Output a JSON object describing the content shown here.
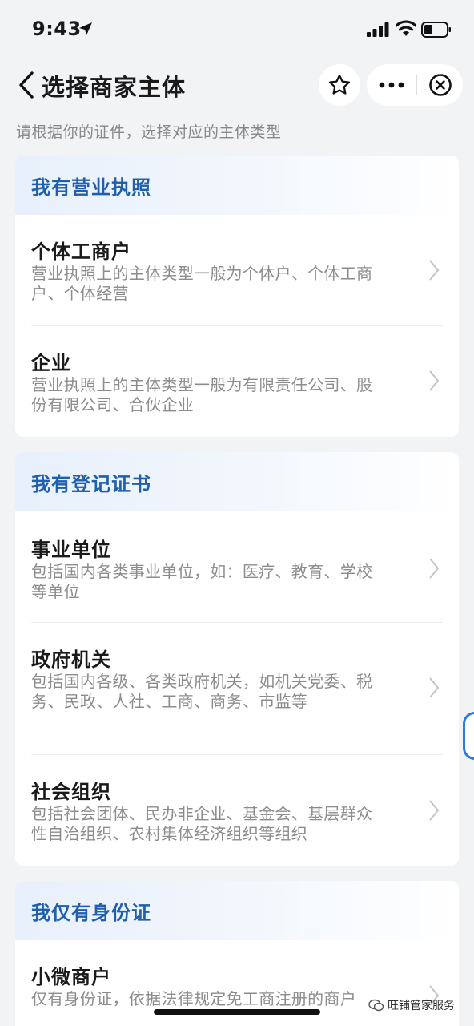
{
  "status_bar": {
    "time": "9:43"
  },
  "nav": {
    "title": "选择商家主体"
  },
  "subtitle": "请根据你的证件，选择对应的主体类型",
  "sections": [
    {
      "header": "我有营业执照",
      "items": [
        {
          "title": "个体工商户",
          "desc": "营业执照上的主体类型一般为个体户、个体工商户、个体经营"
        },
        {
          "title": "企业",
          "desc": "营业执照上的主体类型一般为有限责任公司、股份有限公司、合伙企业"
        }
      ]
    },
    {
      "header": "我有登记证书",
      "items": [
        {
          "title": "事业单位",
          "desc": "包括国内各类事业单位，如：医疗、教育、学校等单位"
        },
        {
          "title": "政府机关",
          "desc": "包括国内各级、各类政府机关，如机关党委、税务、民政、人社、工商、商务、市监等"
        },
        {
          "title": "社会组织",
          "desc": "包括社会团体、民办非企业、基金会、基层群众性自治组织、农村集体经济组织等组织"
        }
      ]
    },
    {
      "header": "我仅有身份证",
      "items": [
        {
          "title": "小微商户",
          "desc": "仅有身份证，依据法律规定免工商注册的商户"
        }
      ]
    }
  ],
  "watermark": "旺铺管家服务",
  "colors": {
    "accent": "#1f5fae",
    "background": "#f2f3f5"
  }
}
